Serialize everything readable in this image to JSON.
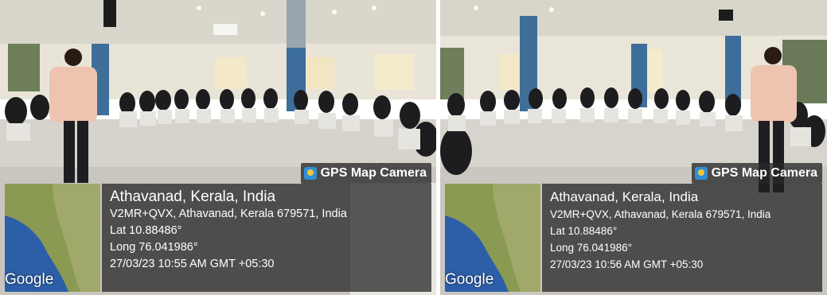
{
  "photos": [
    {
      "badge": "GPS Map Camera",
      "map_label": "Google",
      "place": "Athavanad, Kerala, India",
      "address": "V2MR+QVX, Athavanad, Kerala 679571, India",
      "lat": "Lat 10.88486°",
      "long": "Long 76.041986°",
      "datetime": "27/03/23 10:55 AM GMT +05:30"
    },
    {
      "badge": "GPS Map Camera",
      "map_label": "Google",
      "place": "Athavanad, Kerala, India",
      "address": "V2MR+QVX, Athavanad, Kerala 679571, India",
      "lat": "Lat 10.88486°",
      "long": "Long 76.041986°",
      "datetime": "27/03/23 10:56 AM GMT +05:30"
    }
  ],
  "colors": {
    "overlay_panel": "#1e1e1e",
    "badge_bg": "#282828",
    "sea": "#2d5fa8",
    "land": "#8a9a52"
  }
}
